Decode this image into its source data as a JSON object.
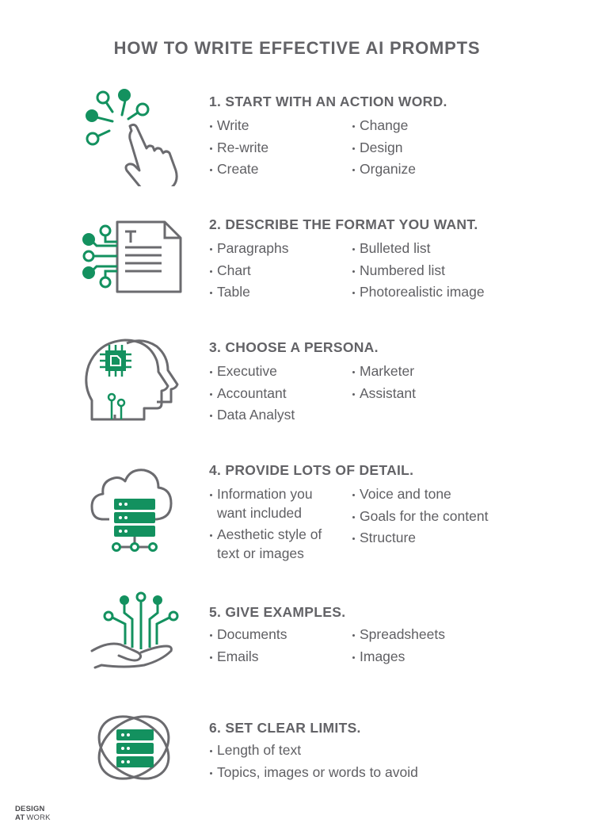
{
  "title": "HOW TO WRITE EFFECTIVE AI PROMPTS",
  "colors": {
    "accent": "#13915f",
    "text": "#5f5f63",
    "icon_stroke": "#6b6b6f"
  },
  "sections": [
    {
      "heading": "1. START WITH AN ACTION WORD.",
      "icon": "hand-tap-nodes-icon",
      "left": [
        "Write",
        "Re-write",
        "Create"
      ],
      "right": [
        "Change",
        "Design",
        "Organize"
      ]
    },
    {
      "heading": "2. DESCRIBE THE FORMAT YOU WANT.",
      "icon": "document-circuit-icon",
      "left": [
        "Paragraphs",
        "Chart",
        "Table"
      ],
      "right": [
        "Bulleted list",
        "Numbered list",
        "Photorealistic image"
      ]
    },
    {
      "heading": "3. CHOOSE A PERSONA.",
      "icon": "head-chip-icon",
      "left": [
        "Executive",
        "Accountant",
        "Data Analyst"
      ],
      "right": [
        "Marketer",
        "Assistant"
      ]
    },
    {
      "heading": "4. PROVIDE LOTS OF DETAIL.",
      "icon": "cloud-server-icon",
      "left": [
        "Information you want included",
        "Aesthetic style of text or images"
      ],
      "right": [
        "Voice and tone",
        "Goals for the content",
        "Structure"
      ]
    },
    {
      "heading": "5. GIVE EXAMPLES.",
      "icon": "hand-circuit-icon",
      "left": [
        "Documents",
        "Emails"
      ],
      "right": [
        "Spreadsheets",
        "Images"
      ]
    },
    {
      "heading": "6. SET CLEAR LIMITS.",
      "icon": "orbit-server-icon",
      "left": [
        "Length of text",
        "Topics, images or words to avoid"
      ],
      "right": []
    }
  ],
  "logo": {
    "line1": "DESIGN",
    "line2_mark": "AT",
    "line2": "WORK"
  }
}
